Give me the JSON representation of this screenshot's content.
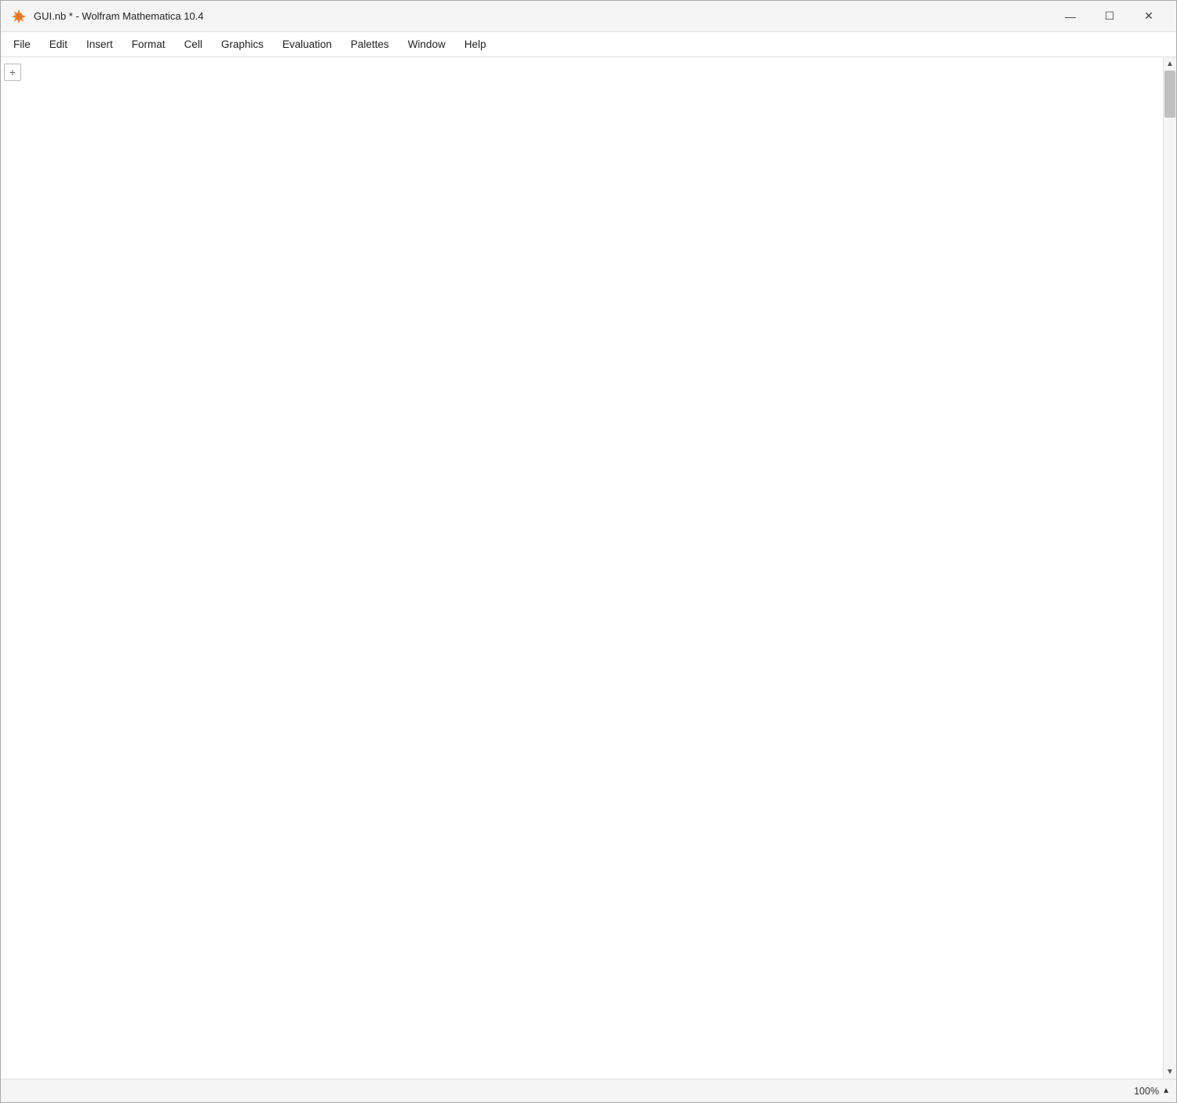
{
  "titleBar": {
    "title": "GUI.nb * - Wolfram Mathematica 10.4",
    "minimizeLabel": "—",
    "maximizeLabel": "☐",
    "closeLabel": "✕"
  },
  "menuBar": {
    "items": [
      {
        "label": "File"
      },
      {
        "label": "Edit"
      },
      {
        "label": "Insert"
      },
      {
        "label": "Format"
      },
      {
        "label": "Cell"
      },
      {
        "label": "Graphics"
      },
      {
        "label": "Evaluation"
      },
      {
        "label": "Palettes"
      },
      {
        "label": "Window"
      },
      {
        "label": "Help"
      }
    ]
  },
  "notebook": {
    "addCellLabel": "+"
  },
  "statusBar": {
    "zoom": "100%",
    "zoomArrow": "▲"
  },
  "scrollbar": {
    "upArrow": "▲",
    "downArrow": "▼"
  }
}
